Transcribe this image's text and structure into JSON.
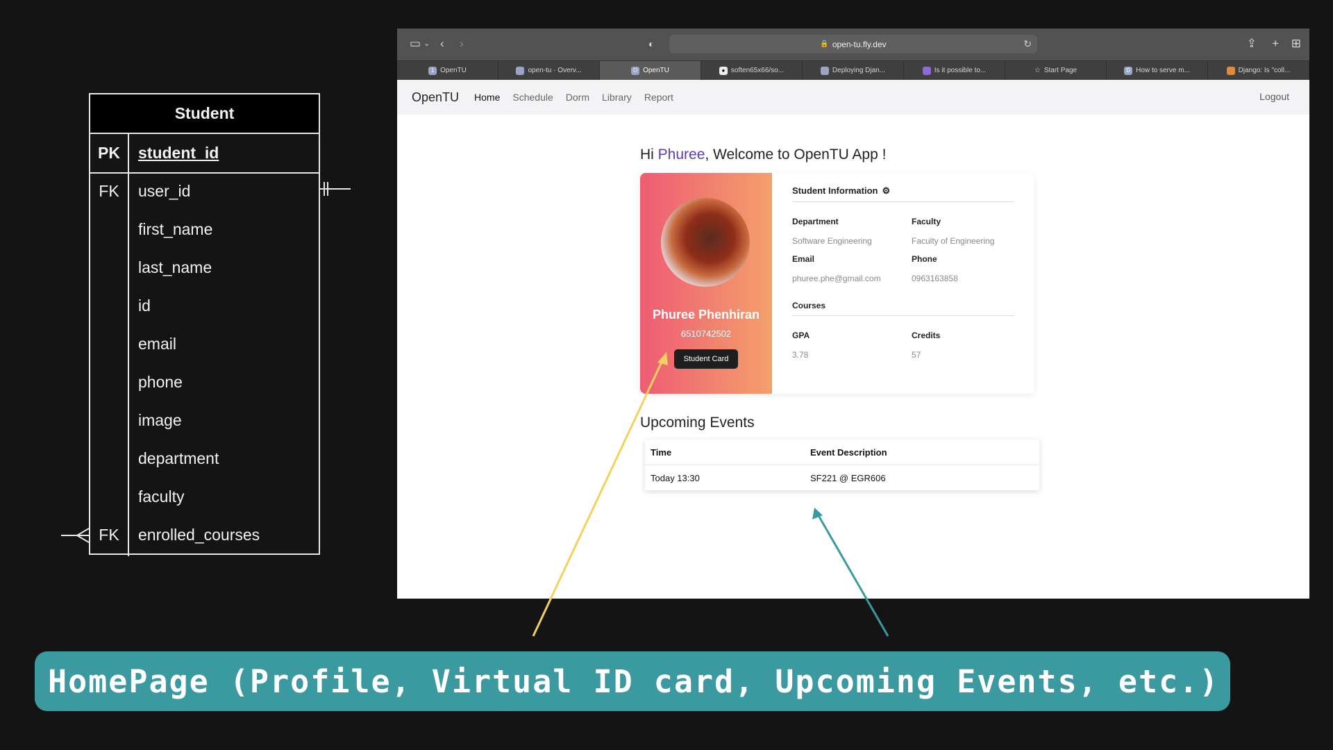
{
  "er": {
    "title": "Student",
    "pk_label": "PK",
    "pk_field": "student_id",
    "fk_label_1": "FK",
    "fk_label_2": "FK",
    "fields": [
      "user_id",
      "first_name",
      "last_name",
      "id",
      "email",
      "phone",
      "image",
      "department",
      "faculty",
      "enrolled_courses"
    ]
  },
  "browser": {
    "url": "open-tu.fly.dev",
    "tabs": [
      "OpenTU",
      "open-tu · Overv...",
      "OpenTU",
      "soften65x66/so...",
      "Deploying Djan...",
      "Is it possible to...",
      "Start Page",
      "How to serve m...",
      "Django: Is \"coll..."
    ],
    "active_tab": 2
  },
  "app": {
    "brand": "OpenTU",
    "nav": [
      "Home",
      "Schedule",
      "Dorm",
      "Library",
      "Report"
    ],
    "logout": "Logout",
    "greeting_prefix": "Hi ",
    "greeting_name": "Phuree",
    "greeting_suffix": ", Welcome to OpenTU App !",
    "profile": {
      "name": "Phuree Phenhiran",
      "student_id": "6510742502",
      "card_button": "Student Card"
    },
    "info": {
      "title": "Student Information",
      "department_label": "Department",
      "department": "Software Engineering",
      "faculty_label": "Faculty",
      "faculty": "Faculty of Engineering",
      "email_label": "Email",
      "email": "phuree.phe@gmail.com",
      "phone_label": "Phone",
      "phone": "0963163858",
      "courses_label": "Courses",
      "gpa_label": "GPA",
      "gpa": "3.78",
      "credits_label": "Credits",
      "credits": "57"
    },
    "events": {
      "title": "Upcoming Events",
      "col_time": "Time",
      "col_desc": "Event Description",
      "rows": [
        {
          "time": "Today 13:30",
          "desc": "SF221 @ EGR606"
        }
      ]
    }
  },
  "caption": "HomePage (Profile, Virtual ID card, Upcoming Events, etc.)",
  "colors": {
    "yellow_arrow": "#f2d160",
    "teal_arrow": "#3a9aa0",
    "caption_bg": "#3a9aa0",
    "accent_name": "#5b3bb5"
  }
}
